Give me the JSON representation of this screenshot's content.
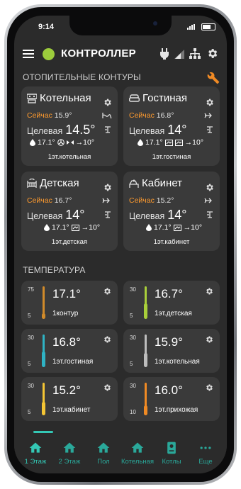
{
  "status": {
    "time": "9:14"
  },
  "app": {
    "title": "КОНТРОЛЛЕР",
    "status_color": "#9ccc3c"
  },
  "sections": {
    "circuits": "ОТОПИТЕЛЬНЫЕ КОНТУРЫ",
    "temperature": "ТЕМПЕРАТУРА"
  },
  "circuits": [
    {
      "name": "Котельная",
      "now_label": "Сейчас",
      "now": "15.9°",
      "target_label": "Целевая",
      "target": "14.5°",
      "water": "17.1°",
      "arrow": "→10°",
      "location": "1эт.котельная",
      "icon": "boiler-room-icon"
    },
    {
      "name": "Гостиная",
      "now_label": "Сейчас",
      "now": "16.8°",
      "target_label": "Целевая",
      "target": "14°",
      "water": "17.1°",
      "arrow": "→10°",
      "location": "1эт.гостиная",
      "icon": "sofa-icon"
    },
    {
      "name": "Детская",
      "now_label": "Сейчас",
      "now": "16.7°",
      "target_label": "Целевая",
      "target": "14°",
      "water": "17.1°",
      "arrow": "→10°",
      "location": "1эт.детская",
      "icon": "crib-icon"
    },
    {
      "name": "Кабинет",
      "now_label": "Сейчас",
      "now": "15.2°",
      "target_label": "Целевая",
      "target": "14°",
      "water": "17.1°",
      "arrow": "→10°",
      "location": "1эт.кабинет",
      "icon": "desk-icon"
    }
  ],
  "sensors": [
    {
      "value": "17.1°",
      "name": "1контур",
      "max": "75",
      "min": "5",
      "color": "#d08a2a",
      "level": 0.17
    },
    {
      "value": "16.7°",
      "name": "1эт.детская",
      "max": "30",
      "min": "5",
      "color": "#a9cf3a",
      "level": 0.47
    },
    {
      "value": "16.8°",
      "name": "1эт.гостиная",
      "max": "30",
      "min": "5",
      "color": "#2fb3c4",
      "level": 0.47
    },
    {
      "value": "15.9°",
      "name": "1эт.котельная",
      "max": "30",
      "min": "5",
      "color": "#bdbdbd",
      "level": 0.44
    },
    {
      "value": "15.2°",
      "name": "1эт.кабинет",
      "max": "30",
      "min": "5",
      "color": "#f4c534",
      "level": 0.41
    },
    {
      "value": "16.0°",
      "name": "1эт.прихожая",
      "max": "30",
      "min": "10",
      "color": "#f08a24",
      "level": 0.3
    }
  ],
  "nav": [
    {
      "label": "1 Этаж",
      "active": true
    },
    {
      "label": "2 Этаж"
    },
    {
      "label": "Пол"
    },
    {
      "label": "Котельная"
    },
    {
      "label": "Котлы"
    },
    {
      "label": "Еще"
    }
  ]
}
